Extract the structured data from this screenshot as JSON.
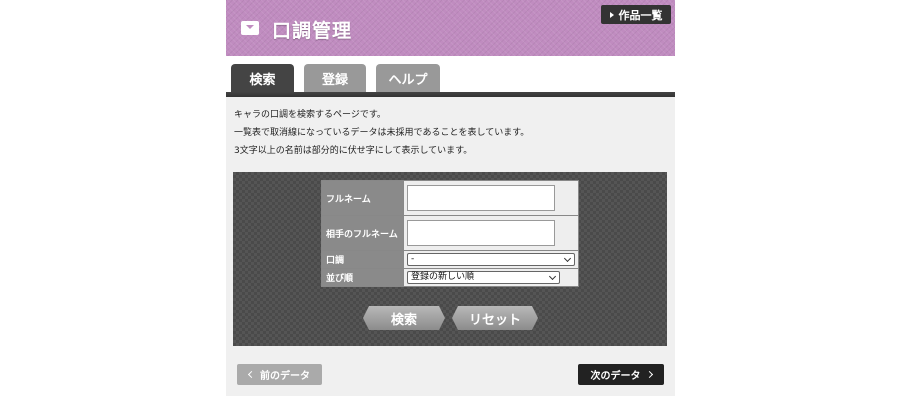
{
  "header": {
    "title": "口調管理",
    "icon": "inbox-icon",
    "works_button": "作品一覧",
    "accent": "#c08cc0"
  },
  "tabs": [
    {
      "label": "検索",
      "active": true
    },
    {
      "label": "登録",
      "active": false
    },
    {
      "label": "ヘルプ",
      "active": false
    }
  ],
  "description": [
    "キャラの口調を検索するページです。",
    "一覧表で取消線になっているデータは未採用であることを表しています。",
    "3文字以上の名前は部分的に伏せ字にして表示しています。"
  ],
  "form": {
    "fullname_label": "フルネーム",
    "fullname_value": "",
    "partner_label": "相手のフルネーム",
    "partner_value": "",
    "tone_label": "口調",
    "tone_selected": "-",
    "order_label": "並び順",
    "order_selected": "登録の新しい順"
  },
  "buttons": {
    "search": "検索",
    "reset": "リセット"
  },
  "nav": {
    "prev": "前のデータ",
    "next": "次のデータ"
  }
}
